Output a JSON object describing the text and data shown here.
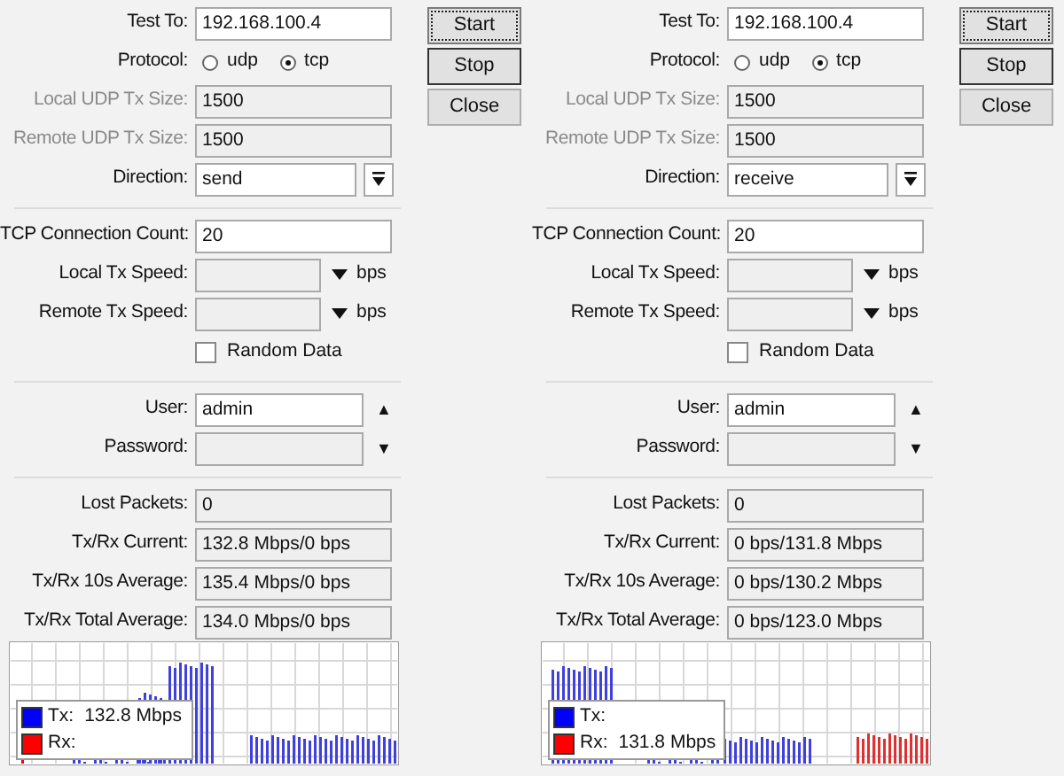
{
  "panels": [
    {
      "rows": [
        {
          "kind": "input",
          "label": "Test To:",
          "value": "192.168.100.4"
        },
        {
          "kind": "radio",
          "label": "Protocol:",
          "options": [
            {
              "label": "udp",
              "selected": false
            },
            {
              "label": "tcp",
              "selected": true
            }
          ]
        },
        {
          "kind": "input",
          "label": "Local UDP Tx Size:",
          "value": "1500",
          "disabled": true
        },
        {
          "kind": "input",
          "label": "Remote UDP Tx Size:",
          "value": "1500",
          "disabled": true
        },
        {
          "kind": "dropdown",
          "label": "Direction:",
          "value": "send"
        },
        {
          "kind": "separator"
        },
        {
          "kind": "input",
          "label": "TCP Connection Count:",
          "value": "20"
        },
        {
          "kind": "speed",
          "label": "Local Tx Speed:",
          "unit": "bps"
        },
        {
          "kind": "speed",
          "label": "Remote Tx Speed:",
          "unit": "bps"
        },
        {
          "kind": "checkbox",
          "label": "Random Data",
          "checked": false
        },
        {
          "kind": "separator"
        },
        {
          "kind": "input",
          "label": "User:",
          "value": "admin",
          "arrow": "▲"
        },
        {
          "kind": "input",
          "label": "Password:",
          "arrow": "▼",
          "readonly": true
        },
        {
          "kind": "separator"
        },
        {
          "kind": "input",
          "label": "Lost Packets:",
          "value": "0",
          "readonly": true
        },
        {
          "kind": "input",
          "label": "Tx/Rx Current:",
          "value": "132.8 Mbps/0 bps",
          "readonly": true
        },
        {
          "kind": "input",
          "label": "Tx/Rx 10s Average:",
          "value": "135.4 Mbps/0 bps",
          "readonly": true
        },
        {
          "kind": "input",
          "label": "Tx/Rx Total Average:",
          "value": "134.0 Mbps/0 bps",
          "readonly": true
        }
      ],
      "legend": [
        {
          "label": "Tx:",
          "value": "132.8 Mbps",
          "color": "#0000ff"
        },
        {
          "label": "Rx:",
          "color": "#ff0000"
        }
      ],
      "buttons": [
        {
          "label": "Start",
          "focused": true
        },
        {
          "label": "Stop",
          "focused": false
        },
        {
          "label": "Close",
          "focused": false
        }
      ]
    },
    {
      "rows": [
        {
          "kind": "input",
          "label": "Test To:",
          "value": "192.168.100.4"
        },
        {
          "kind": "radio",
          "label": "Protocol:",
          "options": [
            {
              "label": "udp",
              "selected": false
            },
            {
              "label": "tcp",
              "selected": true
            }
          ]
        },
        {
          "kind": "input",
          "label": "Local UDP Tx Size:",
          "value": "1500",
          "disabled": true
        },
        {
          "kind": "input",
          "label": "Remote UDP Tx Size:",
          "value": "1500",
          "disabled": true
        },
        {
          "kind": "dropdown",
          "label": "Direction:",
          "value": "receive"
        },
        {
          "kind": "separator"
        },
        {
          "kind": "input",
          "label": "TCP Connection Count:",
          "value": "20"
        },
        {
          "kind": "speed",
          "label": "Local Tx Speed:",
          "unit": "bps"
        },
        {
          "kind": "speed",
          "label": "Remote Tx Speed:",
          "unit": "bps"
        },
        {
          "kind": "checkbox",
          "label": "Random Data",
          "checked": false
        },
        {
          "kind": "separator"
        },
        {
          "kind": "input",
          "label": "User:",
          "value": "admin",
          "arrow": "▲"
        },
        {
          "kind": "input",
          "label": "Password:",
          "arrow": "▼",
          "readonly": true
        },
        {
          "kind": "separator"
        },
        {
          "kind": "input",
          "label": "Lost Packets:",
          "value": "0",
          "readonly": true
        },
        {
          "kind": "input",
          "label": "Tx/Rx Current:",
          "value": "0 bps/131.8 Mbps",
          "readonly": true
        },
        {
          "kind": "input",
          "label": "Tx/Rx 10s Average:",
          "value": "0 bps/130.2 Mbps",
          "readonly": true
        },
        {
          "kind": "input",
          "label": "Tx/Rx Total Average:",
          "value": "0 bps/123.0 Mbps",
          "readonly": true
        }
      ],
      "legend": [
        {
          "label": "Tx:",
          "color": "#0000ff"
        },
        {
          "label": "Rx:",
          "value": "131.8 Mbps",
          "color": "#ff0000"
        }
      ],
      "buttons": [
        {
          "label": "Start",
          "focused": true
        },
        {
          "label": "Stop",
          "focused": false
        },
        {
          "label": "Close",
          "focused": false
        }
      ]
    }
  ]
}
